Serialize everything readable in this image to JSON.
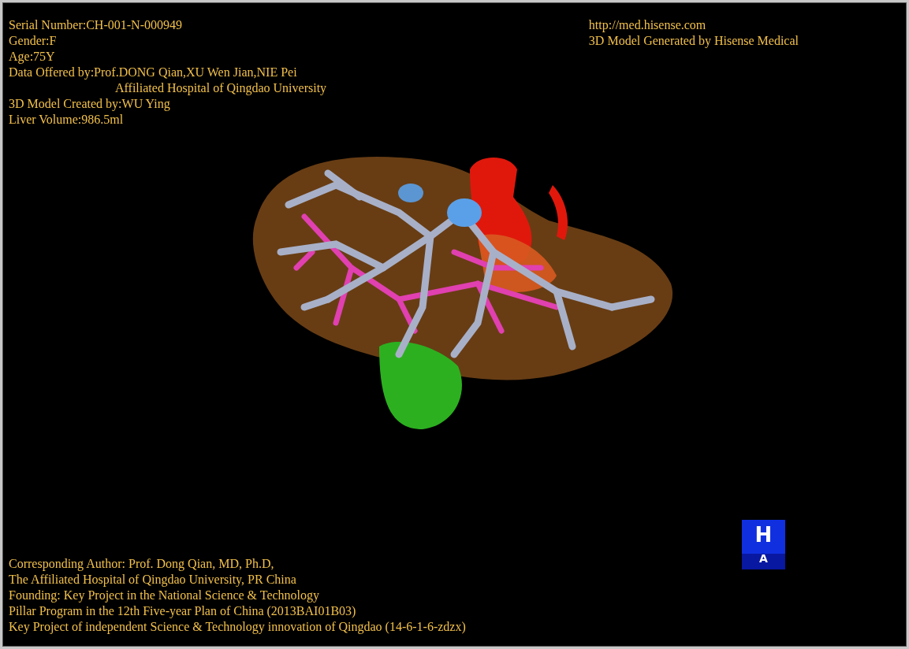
{
  "info": [
    {
      "text": "Serial Number:CH-001-N-000949"
    },
    {
      "text": "Gender:F"
    },
    {
      "text": "Age:75Y"
    },
    {
      "text": "Data Offered by:Prof.DONG Qian,XU Wen Jian,NIE Pei",
      "affiliation": "Affiliated Hospital of Qingdao University"
    },
    {
      "text": "3D Model Created by:WU Ying"
    },
    {
      "text": "Liver Volume:986.5ml"
    }
  ],
  "source": {
    "url": "http://med.hisense.com",
    "note": "3D Model Generated by Hisense Medical"
  },
  "credits": [
    "Corresponding Author: Prof. Dong Qian, MD, Ph.D,",
    "The Affiliated Hospital of Qingdao University, PR China",
    "Founding: Key Project in the National Science & Technology",
    "Pillar Program in the 12th Five-year Plan of China (2013BAI01B03)",
    "Key Project of independent Science & Technology innovation of Qingdao (14-6-1-6-zdzx)"
  ],
  "orientation_cube": {
    "top_label": "H",
    "front_label": "A"
  }
}
